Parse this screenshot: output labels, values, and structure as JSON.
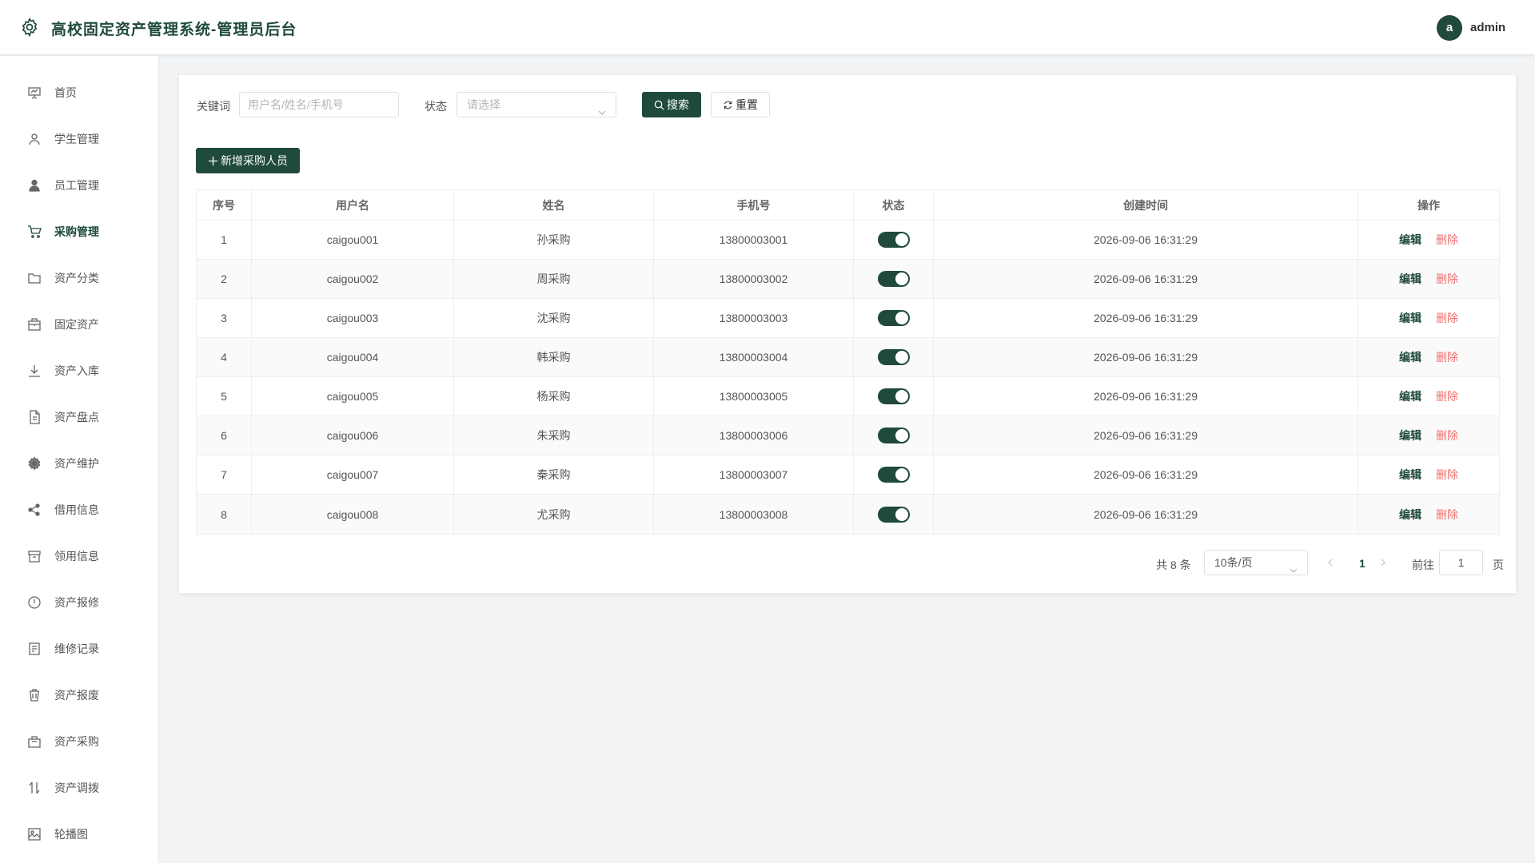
{
  "header": {
    "title": "高校固定资产管理系统-管理员后台",
    "avatar_letter": "a",
    "username": "admin"
  },
  "sidebar": {
    "items": [
      {
        "label": "首页",
        "icon": "presentation-icon",
        "active": false
      },
      {
        "label": "学生管理",
        "icon": "user-icon",
        "active": false
      },
      {
        "label": "员工管理",
        "icon": "user-filled-icon",
        "active": false
      },
      {
        "label": "采购管理",
        "icon": "cart-icon",
        "active": true
      },
      {
        "label": "资产分类",
        "icon": "folder-icon",
        "active": false
      },
      {
        "label": "固定资产",
        "icon": "briefcase-icon",
        "active": false
      },
      {
        "label": "资产入库",
        "icon": "download-icon",
        "active": false
      },
      {
        "label": "资产盘点",
        "icon": "document-icon",
        "active": false
      },
      {
        "label": "资产维护",
        "icon": "gear-icon",
        "active": false
      },
      {
        "label": "借用信息",
        "icon": "share-icon",
        "active": false
      },
      {
        "label": "领用信息",
        "icon": "box-icon",
        "active": false
      },
      {
        "label": "资产报修",
        "icon": "warning-circle-icon",
        "active": false
      },
      {
        "label": "维修记录",
        "icon": "notebook-icon",
        "active": false
      },
      {
        "label": "资产报废",
        "icon": "trash-icon",
        "active": false
      },
      {
        "label": "资产采购",
        "icon": "bag-icon",
        "active": false
      },
      {
        "label": "资产调拨",
        "icon": "sort-icon",
        "active": false
      },
      {
        "label": "轮播图",
        "icon": "picture-icon",
        "active": false
      }
    ]
  },
  "search": {
    "keyword_label": "关键词",
    "keyword_placeholder": "用户名/姓名/手机号",
    "status_label": "状态",
    "status_placeholder": "请选择",
    "search_button": "搜索",
    "reset_button": "重置"
  },
  "toolbar": {
    "add_button": "新增采购人员"
  },
  "table": {
    "columns": [
      "序号",
      "用户名",
      "姓名",
      "手机号",
      "状态",
      "创建时间",
      "操作"
    ],
    "rows": [
      {
        "no": "1",
        "username": "caigou001",
        "name": "孙采购",
        "phone": "13800003001",
        "enabled": true,
        "created": "2026-09-06 16:31:29"
      },
      {
        "no": "2",
        "username": "caigou002",
        "name": "周采购",
        "phone": "13800003002",
        "enabled": true,
        "created": "2026-09-06 16:31:29"
      },
      {
        "no": "3",
        "username": "caigou003",
        "name": "沈采购",
        "phone": "13800003003",
        "enabled": true,
        "created": "2026-09-06 16:31:29"
      },
      {
        "no": "4",
        "username": "caigou004",
        "name": "韩采购",
        "phone": "13800003004",
        "enabled": true,
        "created": "2026-09-06 16:31:29"
      },
      {
        "no": "5",
        "username": "caigou005",
        "name": "杨采购",
        "phone": "13800003005",
        "enabled": true,
        "created": "2026-09-06 16:31:29"
      },
      {
        "no": "6",
        "username": "caigou006",
        "name": "朱采购",
        "phone": "13800003006",
        "enabled": true,
        "created": "2026-09-06 16:31:29"
      },
      {
        "no": "7",
        "username": "caigou007",
        "name": "秦采购",
        "phone": "13800003007",
        "enabled": true,
        "created": "2026-09-06 16:31:29"
      },
      {
        "no": "8",
        "username": "caigou008",
        "name": "尤采购",
        "phone": "13800003008",
        "enabled": true,
        "created": "2026-09-06 16:31:29"
      }
    ],
    "edit_label": "编辑",
    "delete_label": "删除"
  },
  "pagination": {
    "total": "共 8 条",
    "page_size": "10条/页",
    "current_page": "1",
    "goto_label": "前往",
    "goto_value": "1",
    "page_suffix": "页"
  },
  "colors": {
    "primary": "#1f4a3c",
    "danger": "#f07070"
  }
}
